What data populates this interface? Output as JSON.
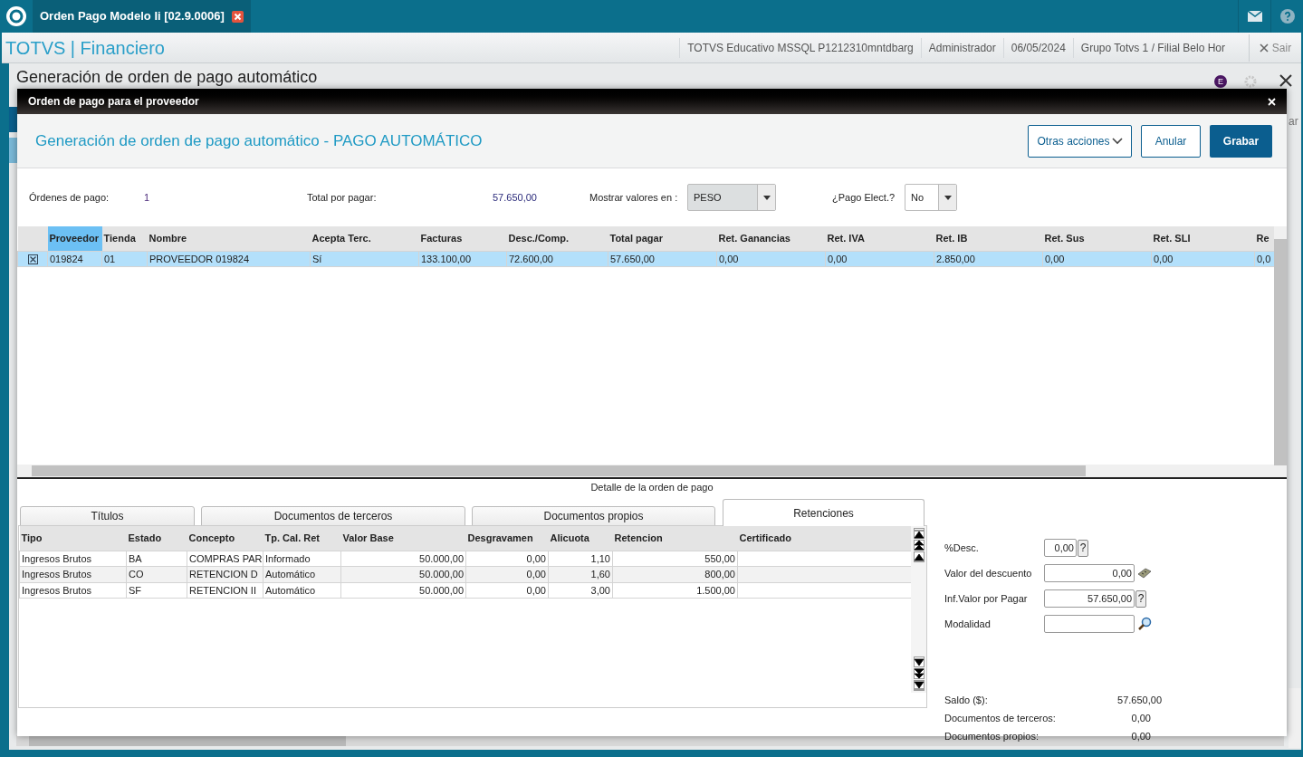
{
  "app_bar": {
    "tab_title": "Orden Pago Modelo Ii [02.9.0006]"
  },
  "header": {
    "brand": "TOTVS",
    "separator": "|",
    "module": "Financiero",
    "info": [
      "TOTVS Educativo MSSQL P1212310mntdbarg",
      "Administrador",
      "06/05/2024",
      "Grupo Totvs 1 / Filial Belo Hor"
    ],
    "exit_button": "Sair"
  },
  "background": {
    "title": "Generación de orden de pago automático",
    "badge": "E",
    "cut_text": "ar"
  },
  "dialog": {
    "title": "Orden de pago para el proveedor",
    "heading": "Generación de orden de pago automático - PAGO AUTOMÁTICO",
    "buttons": [
      {
        "label": "Otras acciones",
        "kind": "menu"
      },
      {
        "label": "Anular",
        "kind": "secondary"
      },
      {
        "label": "Grabar",
        "kind": "primary"
      }
    ],
    "summary": {
      "orders_label": "Órdenes de pago:",
      "orders_value": "1",
      "total_label": "Total por pagar:",
      "total_value": "57.650,00",
      "currency_label": "Mostrar valores en :",
      "currency_value": "PESO",
      "electronic_label": "¿Pago Elect.?",
      "electronic_value": "No"
    },
    "suppliers_table": {
      "columns": [
        {
          "label": "Proveedor",
          "highlighted": true
        },
        {
          "label": "Tienda",
          "highlighted": false
        },
        {
          "label": "Nombre",
          "highlighted": false
        },
        {
          "label": "Acepta Terc.",
          "highlighted": false
        },
        {
          "label": "Facturas",
          "highlighted": false
        },
        {
          "label": "Desc./Comp.",
          "highlighted": false
        },
        {
          "label": "Total pagar",
          "highlighted": false
        },
        {
          "label": "Ret. Ganancias",
          "highlighted": false
        },
        {
          "label": "Ret. IVA",
          "highlighted": false
        },
        {
          "label": "Ret. IB",
          "highlighted": false
        },
        {
          "label": "Ret. Sus",
          "highlighted": false
        },
        {
          "label": "Ret. SLI",
          "highlighted": false
        },
        {
          "label": "Re",
          "highlighted": false
        }
      ],
      "rows": [
        {
          "selected": true,
          "checked": true,
          "cells": [
            "019824",
            "01",
            "PROVEEDOR 019824",
            "Sí",
            "133.100,00",
            "72.600,00",
            "57.650,00",
            "0,00",
            "0,00",
            "2.850,00",
            "0,00",
            "0,00",
            "0,0"
          ]
        }
      ]
    },
    "detail_title": "Detalle de la orden de pago",
    "tabs": [
      {
        "label": "Títulos",
        "selected": false
      },
      {
        "label": "Documentos de terceros",
        "selected": false
      },
      {
        "label": "Documentos propios",
        "selected": false
      },
      {
        "label": "Retenciones",
        "selected": true
      }
    ],
    "retentions_table": {
      "columns": [
        "Tipo",
        "Estado",
        "Concepto",
        "Tp. Cal. Ret",
        "Valor Base",
        "Desgravamen",
        "Alicuota",
        "Retencion",
        "Certificado"
      ],
      "rows": [
        {
          "cells": [
            "Ingresos Brutos",
            "BA",
            "COMPRAS PAR",
            "Informado",
            "50.000,00",
            "0,00",
            "1,10",
            "550,00"
          ]
        },
        {
          "cells": [
            "Ingresos Brutos",
            "CO",
            "RETENCION D",
            "Automático",
            "50.000,00",
            "0,00",
            "1,60",
            "800,00"
          ]
        },
        {
          "cells": [
            "Ingresos Brutos",
            "SF",
            "RETENCION II",
            "Automático",
            "50.000,00",
            "0,00",
            "3,00",
            "1.500,00"
          ]
        }
      ]
    },
    "fields": [
      {
        "label": "%Desc.",
        "value": "0,00",
        "kind": "help",
        "button": "?"
      },
      {
        "label": "Valor del descuento",
        "value": "0,00",
        "kind": "calculator"
      },
      {
        "label": "Inf.Valor por Pagar",
        "value": "57.650,00",
        "kind": "help",
        "button": "?"
      },
      {
        "label": "Modalidad",
        "kind": "search"
      }
    ],
    "balances": [
      {
        "label": "Saldo ($):",
        "value": "57.650,00"
      },
      {
        "label": "Documentos de terceros:",
        "value": "0,00"
      },
      {
        "label": "Documentos propios:",
        "value": "0,00"
      }
    ]
  }
}
